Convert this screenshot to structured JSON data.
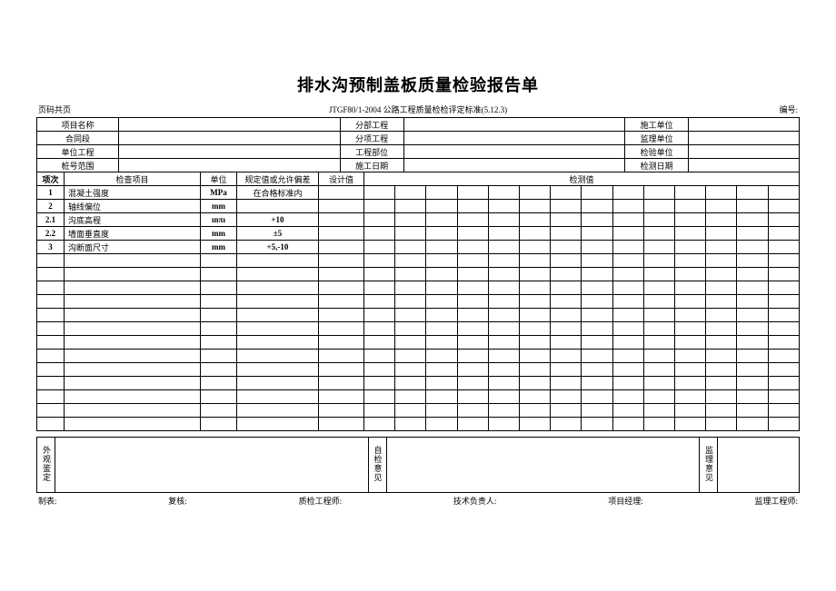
{
  "title": "排水沟预制盖板质量检验报告单",
  "top": {
    "left": "页码共页",
    "mid": "JTGF80/1-2004 公路工程质量检检评定标准(5.12.3)",
    "right_label": "编号:"
  },
  "info": {
    "project_name_label": "项目名称",
    "contract_label": "合同段",
    "unit_proj_label": "单位工程",
    "stake_range_label": "桩号范围",
    "sub_proj_label": "分部工程",
    "item_proj_label": "分项工程",
    "work_part_label": "工程部位",
    "work_date_label": "施工日期",
    "construct_unit_label": "施工单位",
    "supervise_unit_label": "监理单位",
    "inspect_unit_label": "检验单位",
    "detect_date_label": "检测日期"
  },
  "head": {
    "seq": "项次",
    "item": "检查项目",
    "unit": "单位",
    "spec": "规定值或允许偏差",
    "design": "设计值",
    "measured": "检测值"
  },
  "rows": [
    {
      "seq": "1",
      "item": "混凝土强度",
      "unit": "MPa",
      "spec": "在合格标准内"
    },
    {
      "seq": "2",
      "item": "轴线偏位",
      "unit": "mm",
      "spec": ""
    },
    {
      "seq": "2.1",
      "item": "沟底高程",
      "unit": "ınπı",
      "spec": "+10"
    },
    {
      "seq": "2.2",
      "item": "墙面垂直度",
      "unit": "mm",
      "spec": "±5"
    },
    {
      "seq": "3",
      "item": "沟断面尺寸",
      "unit": "mm",
      "spec": "+5,-10"
    }
  ],
  "footer_box": {
    "appearance": "外观鉴定",
    "selfcheck": "自检意见",
    "supervise": "监理意见"
  },
  "sign": {
    "tab": "制表:",
    "review": "复核:",
    "qc_eng": "质检工程师:",
    "tech_lead": "技术负责人:",
    "pm": "项目经理:",
    "sup_eng": "监理工程师:"
  }
}
